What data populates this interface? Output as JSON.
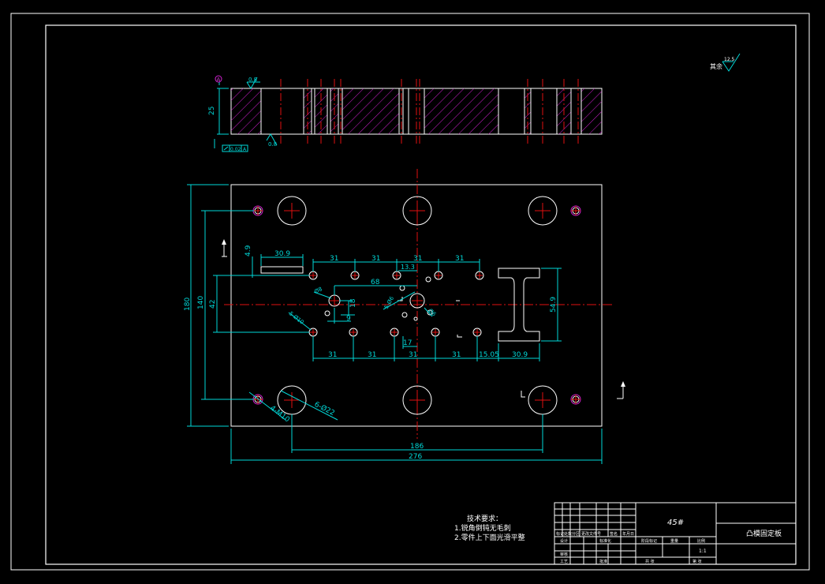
{
  "drawing": {
    "roughness_symbol": "其余",
    "roughness_value": "12.5",
    "section": {
      "datum": "A",
      "surface_roughness_top": "0.8",
      "surface_roughness_bottom": "0.8",
      "thickness": "25",
      "flatness_tol": "0.02",
      "flatness_datum": "A"
    },
    "plan": {
      "overall_width": "276",
      "hole_spacing_x": "186",
      "overall_height": "180",
      "hole_spacing_y": "140",
      "inner_height": "42",
      "pitch_31": "31",
      "slot_length": "30.9",
      "slot_offset": "4.9",
      "dim_68": "68",
      "dim_13_3": "13.3",
      "dim_18": "18",
      "dim_9": "9",
      "dim_17": "17",
      "dim_15_05": "15.05",
      "dim_54_9": "54.9",
      "note_phi8": "Ø8",
      "note_phi6": "Ø6",
      "note_5phi6": "5-Ø6",
      "note_5phi10": "5-Ø10",
      "note_4m10": "4-M10",
      "note_6phi22": "6-Ø22"
    },
    "tech_req": {
      "title": "技术要求：",
      "line1": "1.锐角倒钝无毛刺",
      "line2": "2.零件上下面光滑平整"
    },
    "title_block": {
      "material": "45#",
      "part_name": "凸模固定板",
      "row_labels": [
        "标记",
        "处数",
        "分区",
        "更改文件号",
        "签名",
        "年月日"
      ],
      "row2": [
        "设计",
        "标准化"
      ],
      "row3": [
        "审核",
        "工艺",
        "批准"
      ],
      "stage_headers": [
        "阶段标记",
        "重量",
        "比例"
      ],
      "scale": "1:1",
      "sheet_total": "共 张",
      "sheet_no": "第 张"
    }
  }
}
